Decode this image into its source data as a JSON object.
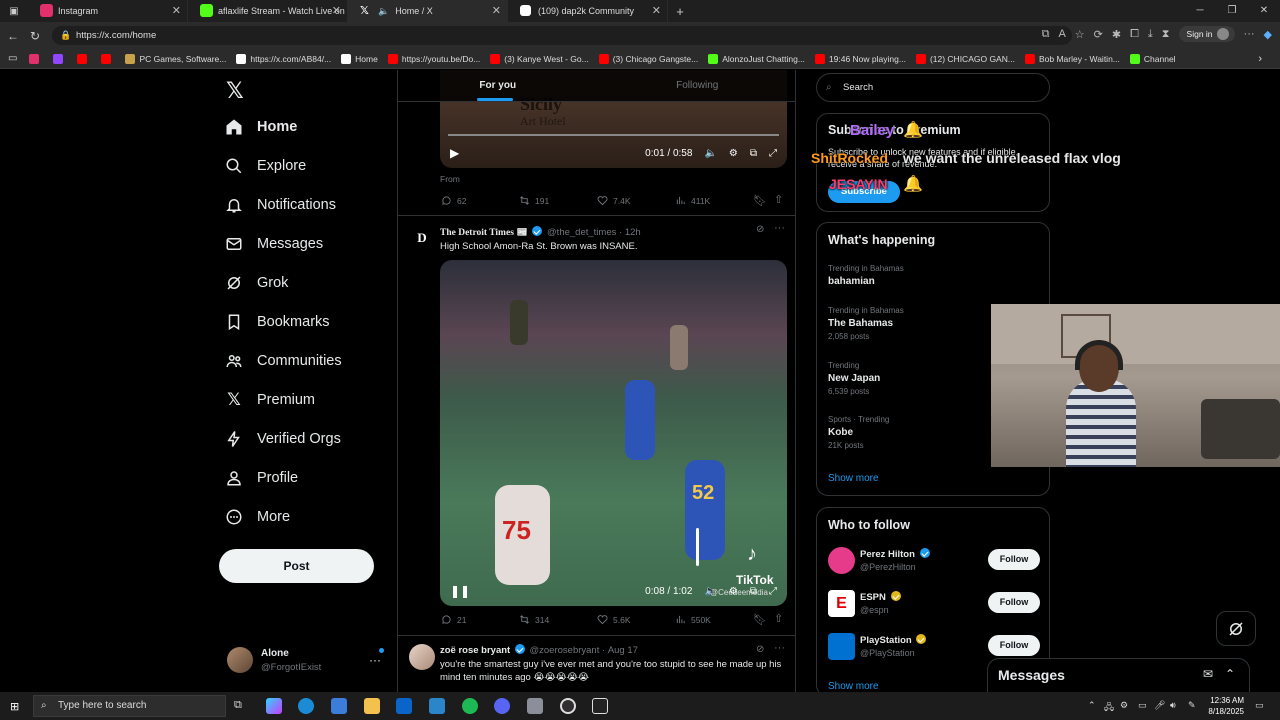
{
  "browser": {
    "tabs": [
      {
        "title": "Instagram",
        "color": "#e1306c"
      },
      {
        "title": "aflaxlife Stream - Watch Live on K",
        "color": "#53fc18"
      },
      {
        "title": "Home / X",
        "color": "#ffffff",
        "active": true
      },
      {
        "title": "(109) dap2k Community",
        "color": "#ffffff"
      }
    ],
    "new_tab": "+",
    "url": "https://x.com/home",
    "sign_in": "Sign in",
    "bookmarks": [
      {
        "label": "",
        "color": "#e1306c"
      },
      {
        "label": "",
        "color": "#9146ff"
      },
      {
        "label": "",
        "color": "#ff0000"
      },
      {
        "label": "",
        "color": "#ff0000"
      },
      {
        "label": "PC Games, Software...",
        "color": "#c8a24a"
      },
      {
        "label": "https://x.com/AB84/...",
        "color": "#ffffff"
      },
      {
        "label": "Home",
        "color": "#ffffff"
      },
      {
        "label": "https://youtu.be/Do...",
        "color": "#ff0000"
      },
      {
        "label": "(3) Kanye West - Go...",
        "color": "#ff0000"
      },
      {
        "label": "(3) Chicago Gangste...",
        "color": "#ff0000"
      },
      {
        "label": "AlonzoJust Chatting...",
        "color": "#53fc18"
      },
      {
        "label": "19:46 Now playing...",
        "color": "#ff0000"
      },
      {
        "label": "(12) CHICAGO GAN...",
        "color": "#ff0000"
      },
      {
        "label": "Bob Marley - Waitin...",
        "color": "#ff0000"
      },
      {
        "label": "Channel",
        "color": "#53fc18"
      }
    ]
  },
  "nav": {
    "items": [
      {
        "label": "Home",
        "icon": "home-icon"
      },
      {
        "label": "Explore",
        "icon": "search-icon"
      },
      {
        "label": "Notifications",
        "icon": "bell-icon"
      },
      {
        "label": "Messages",
        "icon": "envelope-icon"
      },
      {
        "label": "Grok",
        "icon": "grok-icon"
      },
      {
        "label": "Bookmarks",
        "icon": "bookmark-icon"
      },
      {
        "label": "Communities",
        "icon": "people-icon"
      },
      {
        "label": "Premium",
        "icon": "x-icon"
      },
      {
        "label": "Verified Orgs",
        "icon": "lightning-icon"
      },
      {
        "label": "Profile",
        "icon": "person-icon"
      },
      {
        "label": "More",
        "icon": "more-circle-icon"
      }
    ],
    "post_button": "Post",
    "account": {
      "name": "Alone",
      "handle": "@ForgotIExist"
    }
  },
  "timeline": {
    "tabs": [
      "For you",
      "Following"
    ],
    "first_video": {
      "time": "0:01 / 0:58",
      "caption_top": "Sicily",
      "caption_bot": "Art Hotel"
    },
    "first_from": "From",
    "first_actions": {
      "replies": "62",
      "reposts": "191",
      "likes": "7.4K",
      "views": "411K"
    },
    "tweet1": {
      "name": "The Detroit Times",
      "handle": "@the_det_times",
      "time": "12h",
      "text": "High School Amon-Ra St. Brown was INSANE.",
      "video_time": "0:08 / 1:02",
      "watermark": "TikTok",
      "watermark_handle": "@Ceedeemedia",
      "actions": {
        "replies": "21",
        "reposts": "314",
        "likes": "5.6K",
        "views": "550K"
      }
    },
    "tweet2": {
      "name": "zoë rose bryant",
      "handle": "@zoerosebryant",
      "time": "Aug 17",
      "text": "you're the smartest guy i've ever met and you're too stupid to see he made up his mind ten minutes ago 😭😭😭😭😭"
    }
  },
  "right": {
    "search_placeholder": "Search",
    "premium": {
      "title": "Subscribe to Premium",
      "body": "Subscribe to unlock new features and if eligible, receive a share of revenue.",
      "button": "Subscribe"
    },
    "happening": {
      "title": "What's happening",
      "trends": [
        {
          "context": "Trending in Bahamas",
          "topic": "bahamian",
          "posts": ""
        },
        {
          "context": "Trending in Bahamas",
          "topic": "The Bahamas",
          "posts": "2,058 posts"
        },
        {
          "context": "Trending",
          "topic": "New Japan",
          "posts": "6,539 posts"
        },
        {
          "context": "Sports · Trending",
          "topic": "Kobe",
          "posts": "21K posts"
        }
      ],
      "show_more": "Show more"
    },
    "who_to_follow": {
      "title": "Who to follow",
      "accounts": [
        {
          "name": "Perez Hilton",
          "handle": "@PerezHilton",
          "badge": "blue",
          "avatar_color": "#e63a8a",
          "button": "Follow"
        },
        {
          "name": "ESPN",
          "handle": "@espn",
          "badge": "gold",
          "avatar_color": "#ffffff",
          "button": "Follow"
        },
        {
          "name": "PlayStation",
          "handle": "@PlayStation",
          "badge": "gold",
          "avatar_color": "#0070d1",
          "button": "Follow"
        }
      ],
      "show_more": "Show more"
    }
  },
  "messages_drawer": {
    "title": "Messages"
  },
  "stream_overlay": {
    "chat1_user": "Bailey",
    "chat2_user": "ShitRocked",
    "chat2_text": "we want the unreleased flax vlog",
    "chat3_user": "JESAYIN"
  },
  "taskbar": {
    "search_placeholder": "Type here to search",
    "time": "12:36 AM",
    "date": "8/18/2025"
  }
}
